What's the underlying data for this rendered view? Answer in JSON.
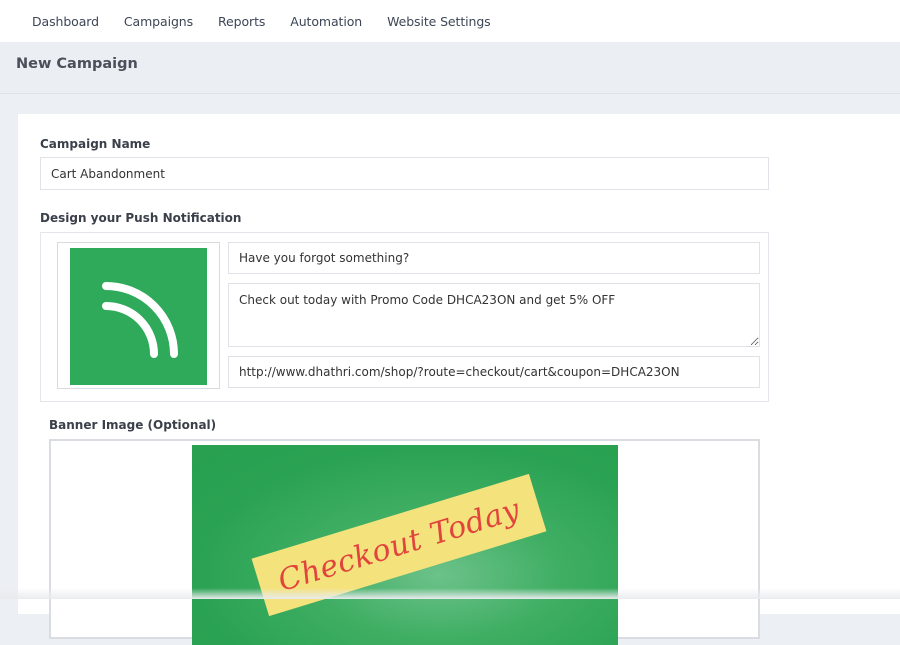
{
  "nav": {
    "items": [
      "Dashboard",
      "Campaigns",
      "Reports",
      "Automation",
      "Website Settings"
    ]
  },
  "page": {
    "title": "New Campaign"
  },
  "form": {
    "campaign_name_label": "Campaign Name",
    "campaign_name_value": "Cart Abandonment",
    "design_label": "Design your Push Notification",
    "notification_title": "Have you forgot something?",
    "notification_message": "Check out today with Promo Code DHCA23ON and get 5% OFF",
    "notification_url": "http://www.dhathri.com/shop/?route=checkout/cart&coupon=DHCA23ON",
    "icon": "rss-feed-icon",
    "banner_label": "Banner Image (Optional)",
    "banner_text": "Checkout Today"
  },
  "colors": {
    "icon_bg": "#2eaa5a",
    "banner_green": "#2aa253",
    "sign_yellow": "#f4e27d",
    "sign_text": "#e0443c"
  }
}
